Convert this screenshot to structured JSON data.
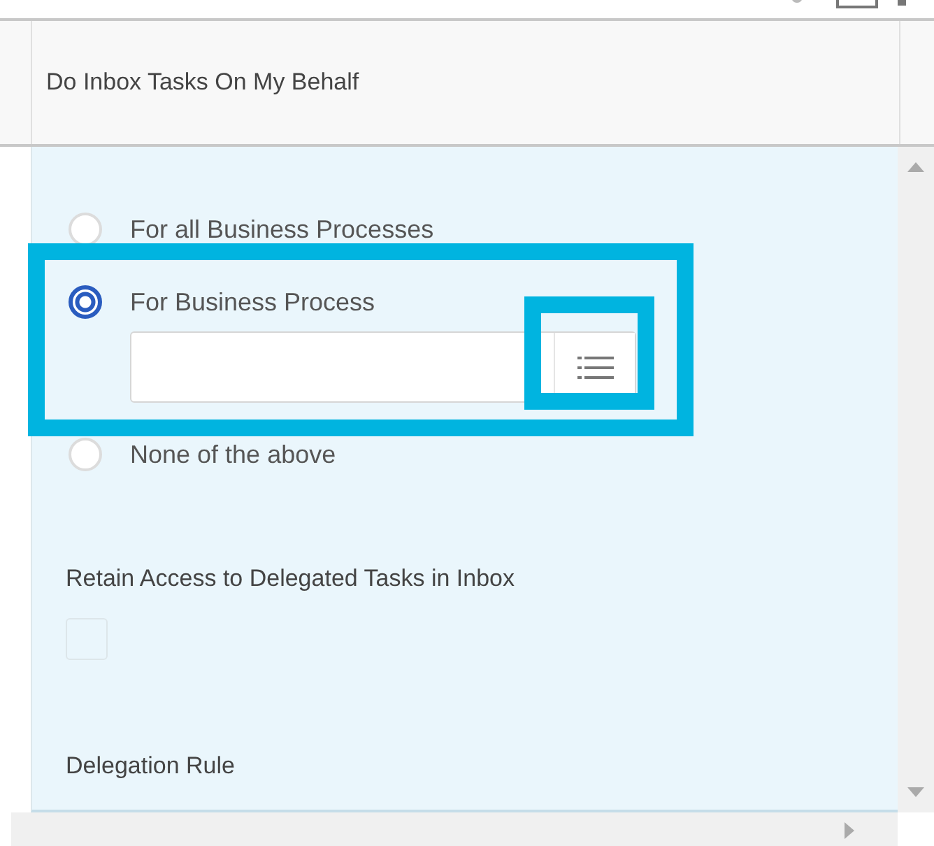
{
  "header": {
    "title": "Do Inbox Tasks On My Behalf"
  },
  "options": [
    {
      "label": "For all Business Processes",
      "selected": false,
      "kind": "plain"
    },
    {
      "label": "For Business Process",
      "selected": true,
      "kind": "prompt"
    },
    {
      "label": "None of the above",
      "selected": false,
      "kind": "plain"
    }
  ],
  "retain_access": {
    "label": "Retain Access to Delegated Tasks in Inbox",
    "checked": false
  },
  "delegation_rule": {
    "label": "Delegation Rule"
  }
}
